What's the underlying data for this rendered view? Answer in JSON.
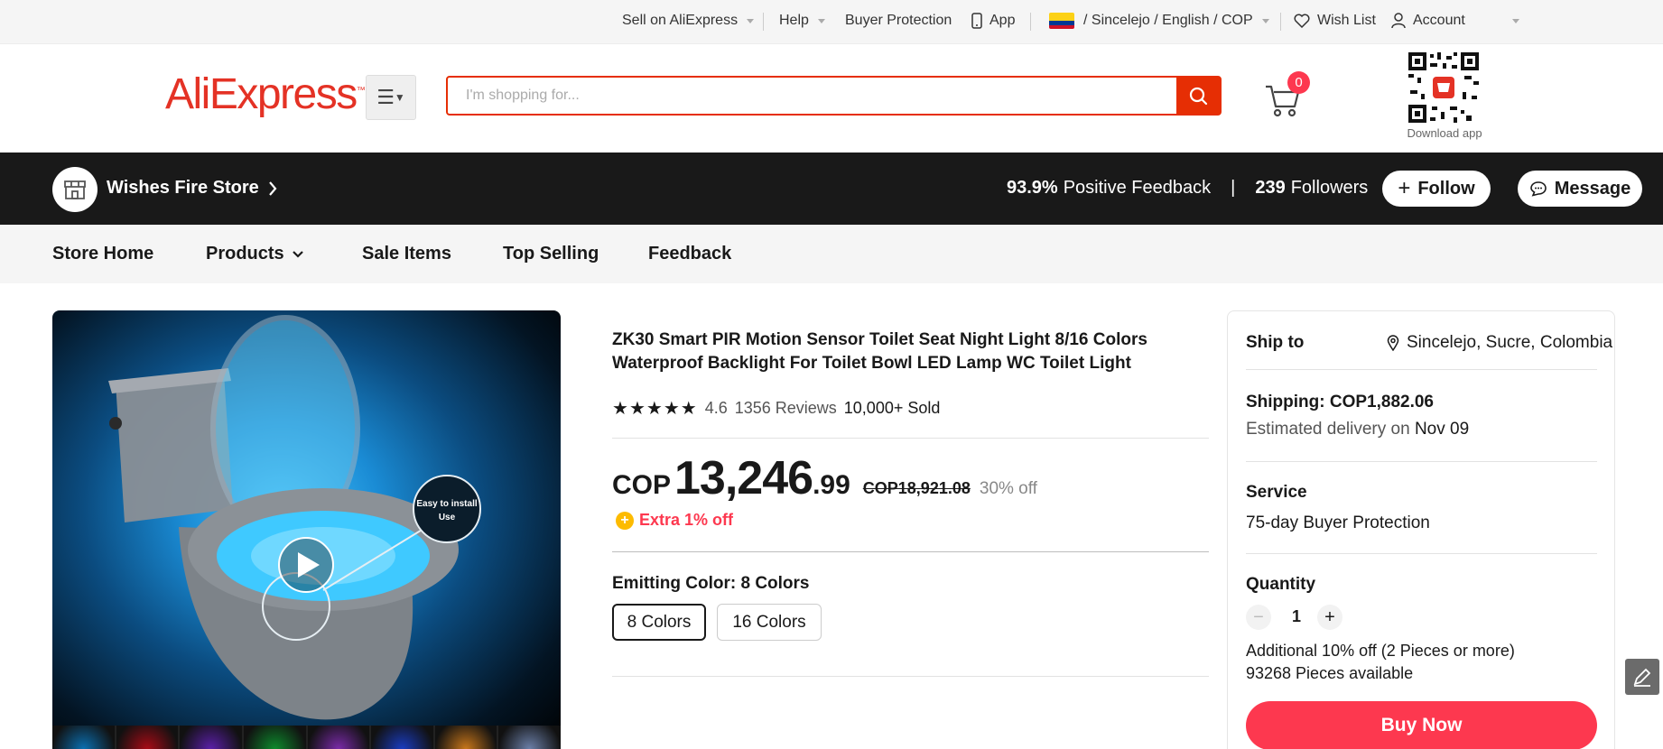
{
  "topbar": {
    "sell": "Sell on AliExpress",
    "help": "Help",
    "buyer_protection": "Buyer Protection",
    "app": "App",
    "locale": "/ Sincelejo / English /  COP",
    "wish_list": "Wish List",
    "account": "Account"
  },
  "header": {
    "logo": "AliExpress",
    "search_placeholder": "I'm shopping for...",
    "cart_count": "0",
    "qr_label": "Download app"
  },
  "store": {
    "name": "Wishes Fire Store",
    "feedback_value": "93.9%",
    "feedback_label": "Positive Feedback",
    "separator": "|",
    "followers_value": "239",
    "followers_label": "Followers",
    "follow_label": "Follow",
    "message_label": "Message"
  },
  "store_nav": {
    "home": "Store Home",
    "products": "Products",
    "sale": "Sale Items",
    "top": "Top Selling",
    "feedback": "Feedback"
  },
  "product": {
    "image_badge_line1": "Easy to install",
    "image_badge_line2": "Use",
    "title": "ZK30 Smart PIR Motion Sensor Toilet Seat Night Light 8/16 Colors Waterproof Backlight For Toilet Bowl LED Lamp WC Toilet Light",
    "rating": "4.6",
    "reviews": "1356 Reviews",
    "sold": "10,000+ Sold",
    "stars_count": 5,
    "price_currency": "COP",
    "price_int": "13,246",
    "price_dec": ".99",
    "price_original": "COP18,921.08",
    "discount": "30% off",
    "extra": "Extra 1% off",
    "emit_label": "Emitting Color: 8 Colors",
    "options": [
      "8 Colors",
      "16 Colors"
    ],
    "thumb_colors": [
      "#0b6fb0",
      "#a80b16",
      "#5b1fa8",
      "#0d8a2c",
      "#7a2aa8",
      "#1a3cc0",
      "#c8761a",
      "#6b7fa8"
    ]
  },
  "panel": {
    "ship_to_label": "Ship to",
    "ship_to_value": "Sincelejo, Sucre, Colombia",
    "shipping": "Shipping: COP1,882.06",
    "est_delivery": "Estimated delivery on",
    "delivery_date": "Nov 09",
    "service_label": "Service",
    "service_value": "75-day Buyer Protection",
    "quantity_label": "Quantity",
    "quantity_value": "1",
    "additional": "Additional 10% off (2 Pieces or more)",
    "available": "93268 Pieces available",
    "buy_now": "Buy Now"
  },
  "colors": {
    "brand_red": "#e43225",
    "search_red": "#e62e04",
    "buy_red": "#fd384f",
    "store_bar": "#191919"
  }
}
